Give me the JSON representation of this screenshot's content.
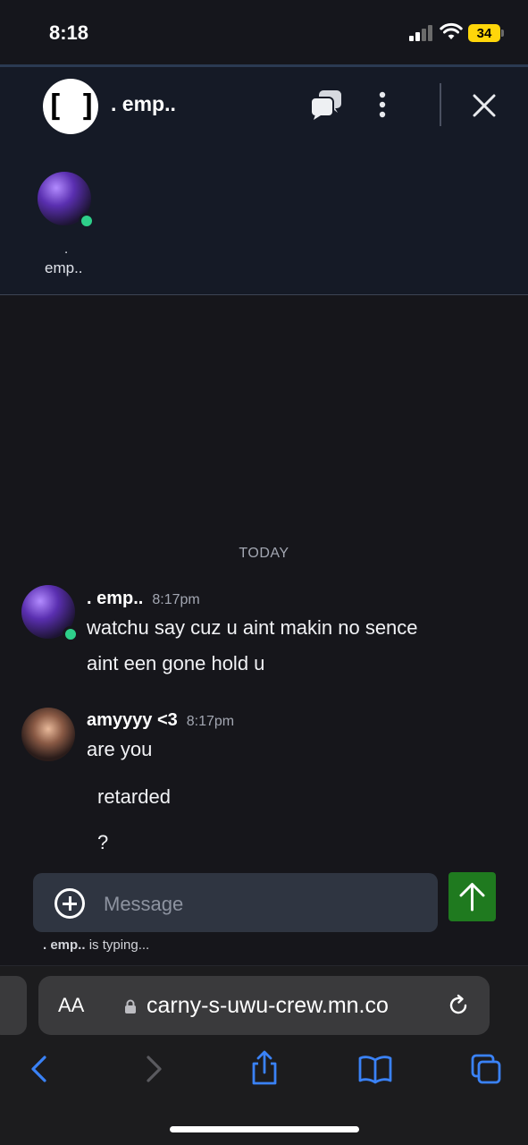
{
  "status_bar": {
    "time": "8:18",
    "battery": "34"
  },
  "header": {
    "group_icon_text": "[ ]",
    "title": ". emp..",
    "member": {
      "dot": ".",
      "name": "emp.."
    }
  },
  "chat": {
    "date_separator": "TODAY",
    "messages": [
      {
        "sender": ". emp..",
        "time": "8:17pm",
        "lines": [
          "watchu say cuz u aint makin no sence",
          "aint een gone hold u"
        ]
      },
      {
        "sender": "amyyyy <3",
        "time": "8:17pm",
        "lines": [
          "are you",
          "retarded",
          "?"
        ]
      }
    ]
  },
  "composer": {
    "placeholder": "Message",
    "typing_user": ". emp..",
    "typing_suffix": "is typing..."
  },
  "browser": {
    "aa_label": "AA",
    "url": "carny-s-uwu-crew.mn.co"
  },
  "colors": {
    "online": "#2ecf8a",
    "send_button": "#1f7a1f",
    "accent_blue": "#3a82f7",
    "battery": "#ffd60a"
  }
}
